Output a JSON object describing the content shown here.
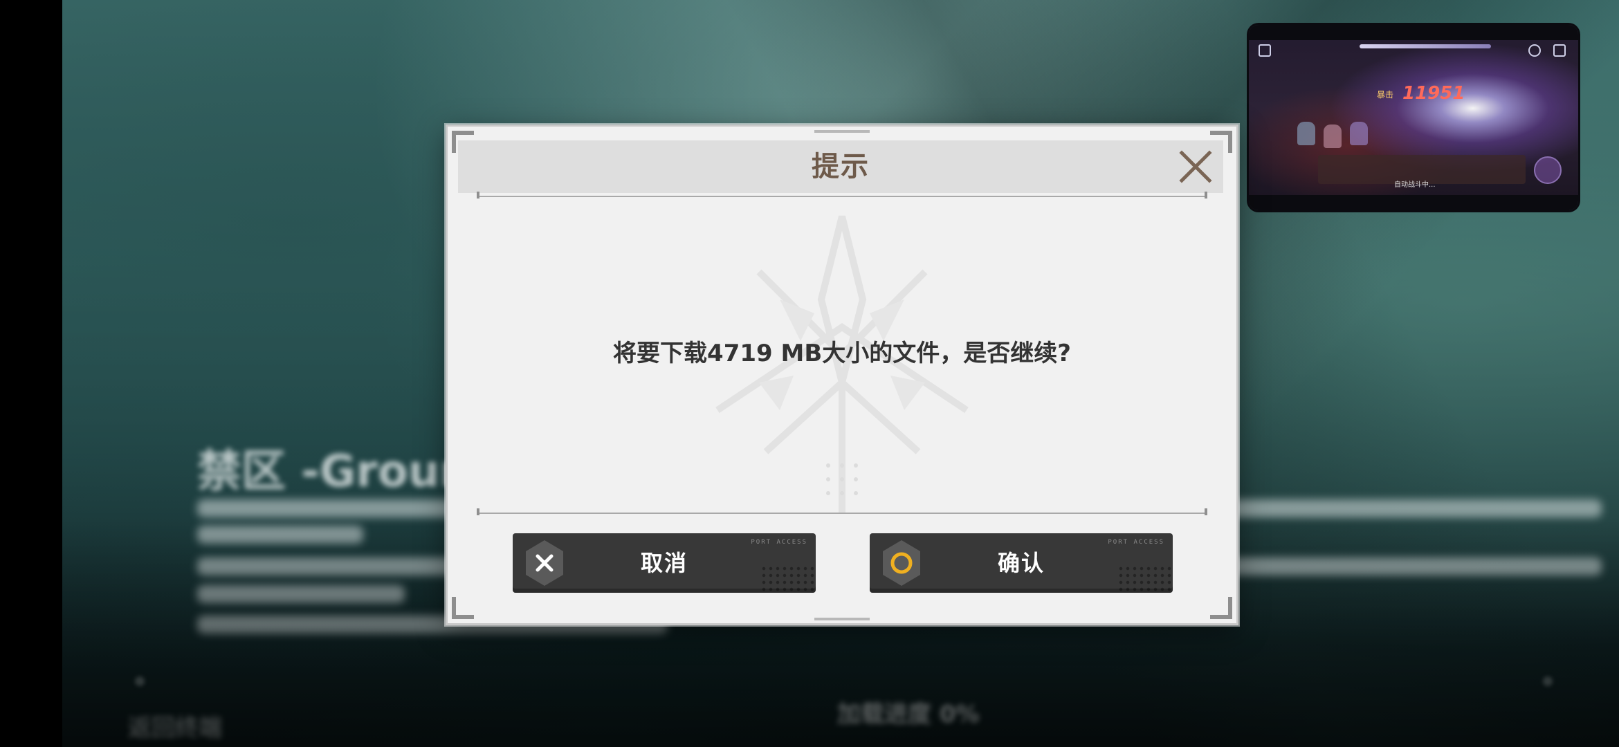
{
  "background": {
    "title": "禁区 -Ground Zero",
    "status": "加载进度 0%",
    "corner_label": "返回终端"
  },
  "dialog": {
    "title": "提示",
    "close_icon": "close-icon",
    "message": "将要下载4719 MB大小的文件，是否继续?",
    "cancel": {
      "label": "取消",
      "sublabel": "PORT ACCESS",
      "icon": "x-hexagon-icon"
    },
    "confirm": {
      "label": "确认",
      "sublabel": "PORT ACCESS",
      "icon": "circle-hexagon-icon"
    },
    "accent_color": "#6e5a4a",
    "confirm_icon_color": "#f0b020"
  },
  "preview": {
    "damage_label": "暴击",
    "damage": "11951",
    "hud_caption": "自动战斗中..."
  }
}
